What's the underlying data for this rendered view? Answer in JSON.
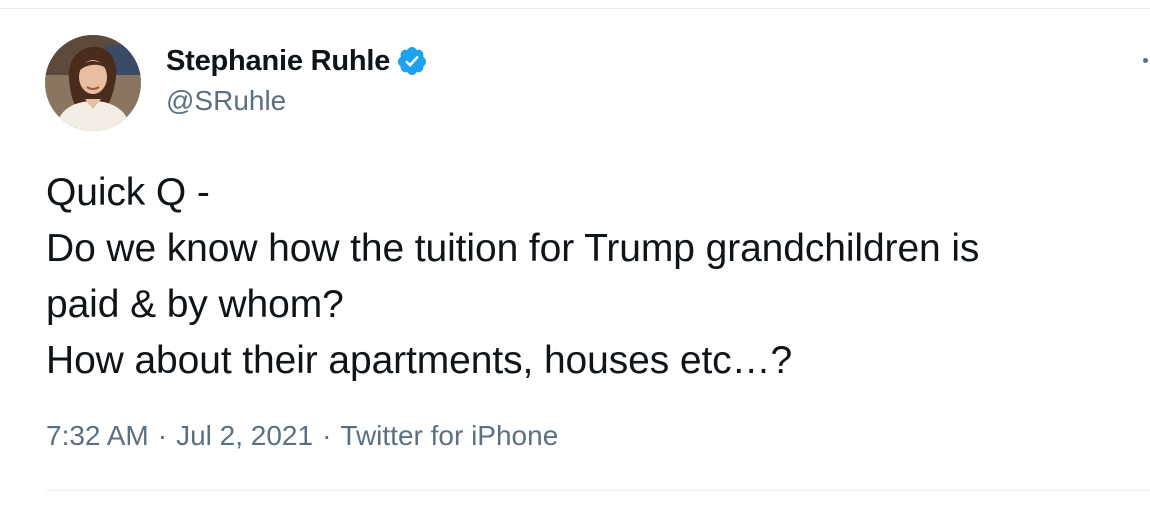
{
  "author": {
    "display_name": "Stephanie Ruhle",
    "handle": "@SRuhle",
    "verified": true,
    "avatar_icon": "profile-photo",
    "verified_icon": "verified-badge-icon",
    "verified_color": "#1da1f2"
  },
  "tweet": {
    "lines": [
      "Quick Q -",
      "Do we know how the tuition for Trump grandchildren is",
      "paid & by whom?",
      "How about their apartments, houses etc…?"
    ]
  },
  "meta": {
    "time": "7:32 AM",
    "separator": "·",
    "date": "Jul 2, 2021",
    "source": "Twitter for iPhone"
  },
  "colors": {
    "text": "#0f1419",
    "secondary": "#5b7083",
    "divider": "#ebeef0"
  }
}
